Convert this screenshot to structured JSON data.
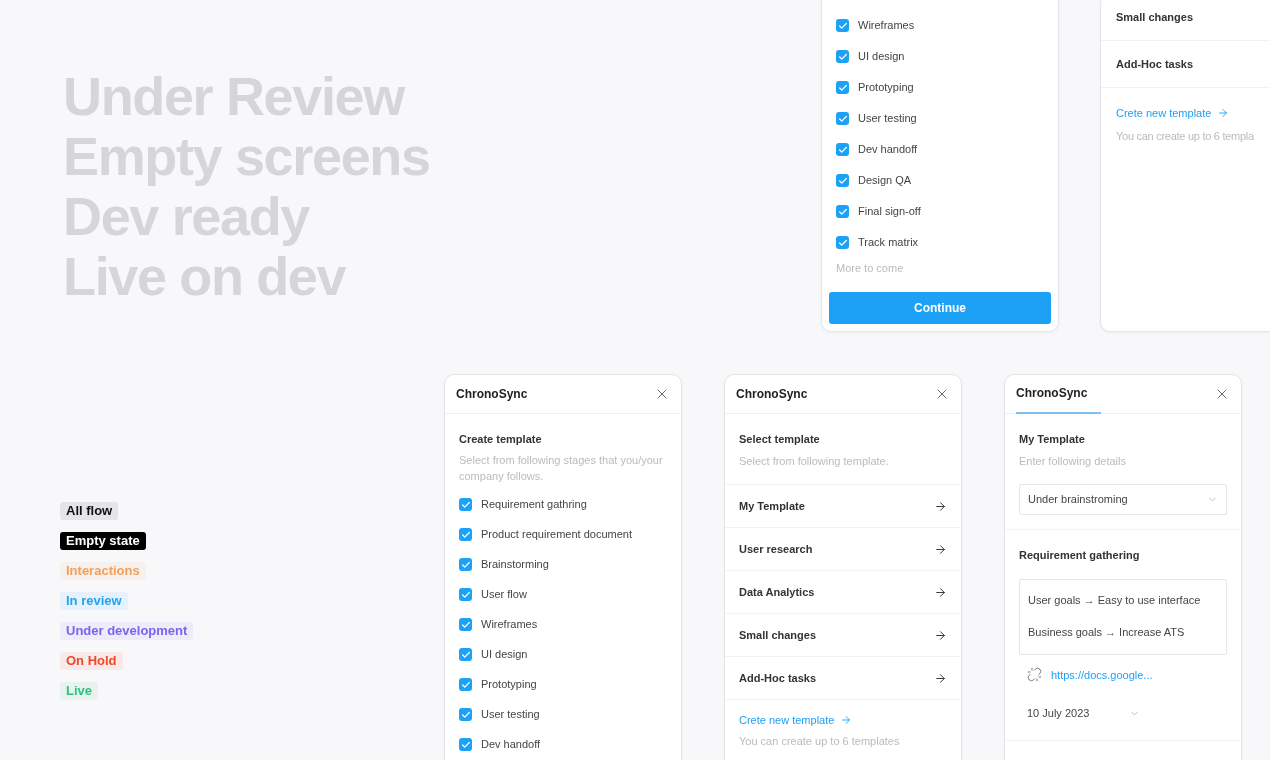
{
  "headline_lines": [
    "Under Review",
    "Empty screens",
    "Dev ready",
    "Live on dev"
  ],
  "tags": [
    {
      "label": "All flow",
      "kind": "soft",
      "color": "#111111"
    },
    {
      "label": "Empty state",
      "kind": "solid",
      "color": "#000000"
    },
    {
      "label": "Interactions",
      "kind": "soft",
      "color": "#f2a05c"
    },
    {
      "label": "In review",
      "kind": "soft",
      "color": "#22a3f3"
    },
    {
      "label": "Under development",
      "kind": "soft",
      "color": "#7a64ef"
    },
    {
      "label": "On Hold",
      "kind": "soft",
      "color": "#f0482c"
    },
    {
      "label": "Live",
      "kind": "soft",
      "color": "#2ec27e"
    }
  ],
  "top_stage_panel": {
    "stages": [
      {
        "label": "Wireframes",
        "checked": true
      },
      {
        "label": "UI design",
        "checked": true
      },
      {
        "label": "Prototyping",
        "checked": true
      },
      {
        "label": "User testing",
        "checked": true
      },
      {
        "label": "Dev handoff",
        "checked": true
      },
      {
        "label": "Design QA",
        "checked": true
      },
      {
        "label": "Final sign-off",
        "checked": true
      },
      {
        "label": "Track matrix",
        "checked": true
      }
    ],
    "more_note": "More to come",
    "button": "Continue"
  },
  "top_template_panel": {
    "templates": [
      "Small changes",
      "Add-Hoc tasks"
    ],
    "create_link": "Crete new template",
    "limit_note": "You can create up to 6 templa"
  },
  "stage_panel": {
    "title": "ChronoSync",
    "tab_selected": false,
    "heading": "Create template",
    "subheading": "Select from following stages that you/your company follows.",
    "stages": [
      {
        "label": "Requirement gathring",
        "checked": true
      },
      {
        "label": "Product requirement document",
        "checked": true
      },
      {
        "label": "Brainstorming",
        "checked": true
      },
      {
        "label": "User flow",
        "checked": true
      },
      {
        "label": "Wireframes",
        "checked": true
      },
      {
        "label": "UI design",
        "checked": true
      },
      {
        "label": "Prototyping",
        "checked": true
      },
      {
        "label": "User testing",
        "checked": true
      },
      {
        "label": "Dev handoff",
        "checked": true
      }
    ]
  },
  "template_panel": {
    "title": "ChronoSync",
    "tab_selected": false,
    "heading": "Select template",
    "subheading": "Select from following template.",
    "templates": [
      "My Template",
      "User research",
      "Data Analytics",
      "Small changes",
      "Add-Hoc tasks"
    ],
    "create_link": "Crete new template",
    "limit_note": "You can create up to 6 templates"
  },
  "details_panel": {
    "title": "ChronoSync",
    "tab_selected": true,
    "heading": "My Template",
    "subheading": "Enter following details",
    "status_select": "Under brainstroming",
    "section_heading": "Requirement gathering",
    "goals": [
      "User goals → Easy to use interface",
      "Business goals → Increase ATS"
    ],
    "link": "https://docs.google...",
    "date": "10 July 2023"
  }
}
